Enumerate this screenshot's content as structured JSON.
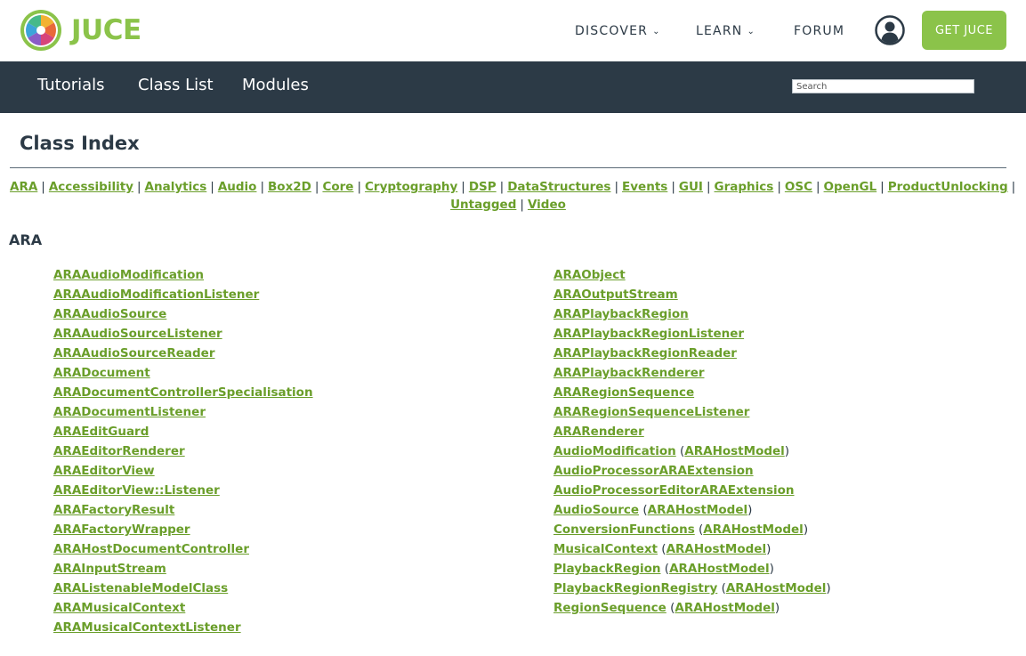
{
  "header": {
    "logo_text": "JUCE",
    "nav": [
      {
        "label": "DISCOVER",
        "chevron": "⌄"
      },
      {
        "label": "LEARN",
        "chevron": "⌄"
      },
      {
        "label": "FORUM"
      }
    ],
    "user_icon": "user-avatar-icon",
    "cta_label": "GET JUCE"
  },
  "subnav": {
    "tabs": [
      "Tutorials",
      "Class List",
      "Modules"
    ],
    "search_placeholder": "Search"
  },
  "page": {
    "title": "Class Index",
    "quick_index": [
      "ARA",
      "Accessibility",
      "Analytics",
      "Audio",
      "Box2D",
      "Core",
      "Cryptography",
      "DSP",
      "DataStructures",
      "Events",
      "GUI",
      "Graphics",
      "OSC",
      "OpenGL",
      "ProductUnlocking",
      "Untagged",
      "Video"
    ],
    "separator": "|",
    "section_letter": "ARA",
    "column1": [
      {
        "name": "ARAAudioModification"
      },
      {
        "name": "ARAAudioModificationListener"
      },
      {
        "name": "ARAAudioSource"
      },
      {
        "name": "ARAAudioSourceListener"
      },
      {
        "name": "ARAAudioSourceReader"
      },
      {
        "name": "ARADocument"
      },
      {
        "name": "ARADocumentControllerSpecialisation"
      },
      {
        "name": "ARADocumentListener"
      },
      {
        "name": "ARAEditGuard"
      },
      {
        "name": "ARAEditorRenderer"
      },
      {
        "name": "ARAEditorView"
      },
      {
        "name": "ARAEditorView::Listener"
      },
      {
        "name": "ARAFactoryResult"
      },
      {
        "name": "ARAFactoryWrapper"
      },
      {
        "name": "ARAHostDocumentController"
      },
      {
        "name": "ARAInputStream"
      },
      {
        "name": "ARAListenableModelClass"
      },
      {
        "name": "ARAMusicalContext"
      },
      {
        "name": "ARAMusicalContextListener"
      }
    ],
    "column2": [
      {
        "name": "ARAObject"
      },
      {
        "name": "ARAOutputStream"
      },
      {
        "name": "ARAPlaybackRegion"
      },
      {
        "name": "ARAPlaybackRegionListener"
      },
      {
        "name": "ARAPlaybackRegionReader"
      },
      {
        "name": "ARAPlaybackRenderer"
      },
      {
        "name": "ARARegionSequence"
      },
      {
        "name": "ARARegionSequenceListener"
      },
      {
        "name": "ARARenderer"
      },
      {
        "name": "AudioModification",
        "ns": "ARAHostModel"
      },
      {
        "name": "AudioProcessorARAExtension"
      },
      {
        "name": "AudioProcessorEditorARAExtension"
      },
      {
        "name": "AudioSource",
        "ns": "ARAHostModel"
      },
      {
        "name": "ConversionFunctions",
        "ns": "ARAHostModel"
      },
      {
        "name": "MusicalContext",
        "ns": "ARAHostModel"
      },
      {
        "name": "PlaybackRegion",
        "ns": "ARAHostModel"
      },
      {
        "name": "PlaybackRegionRegistry",
        "ns": "ARAHostModel"
      },
      {
        "name": "RegionSequence",
        "ns": "ARAHostModel"
      }
    ]
  },
  "colors": {
    "link": "#6a9e2a",
    "brand_green": "#8bc34a",
    "dark": "#2c3a46"
  }
}
